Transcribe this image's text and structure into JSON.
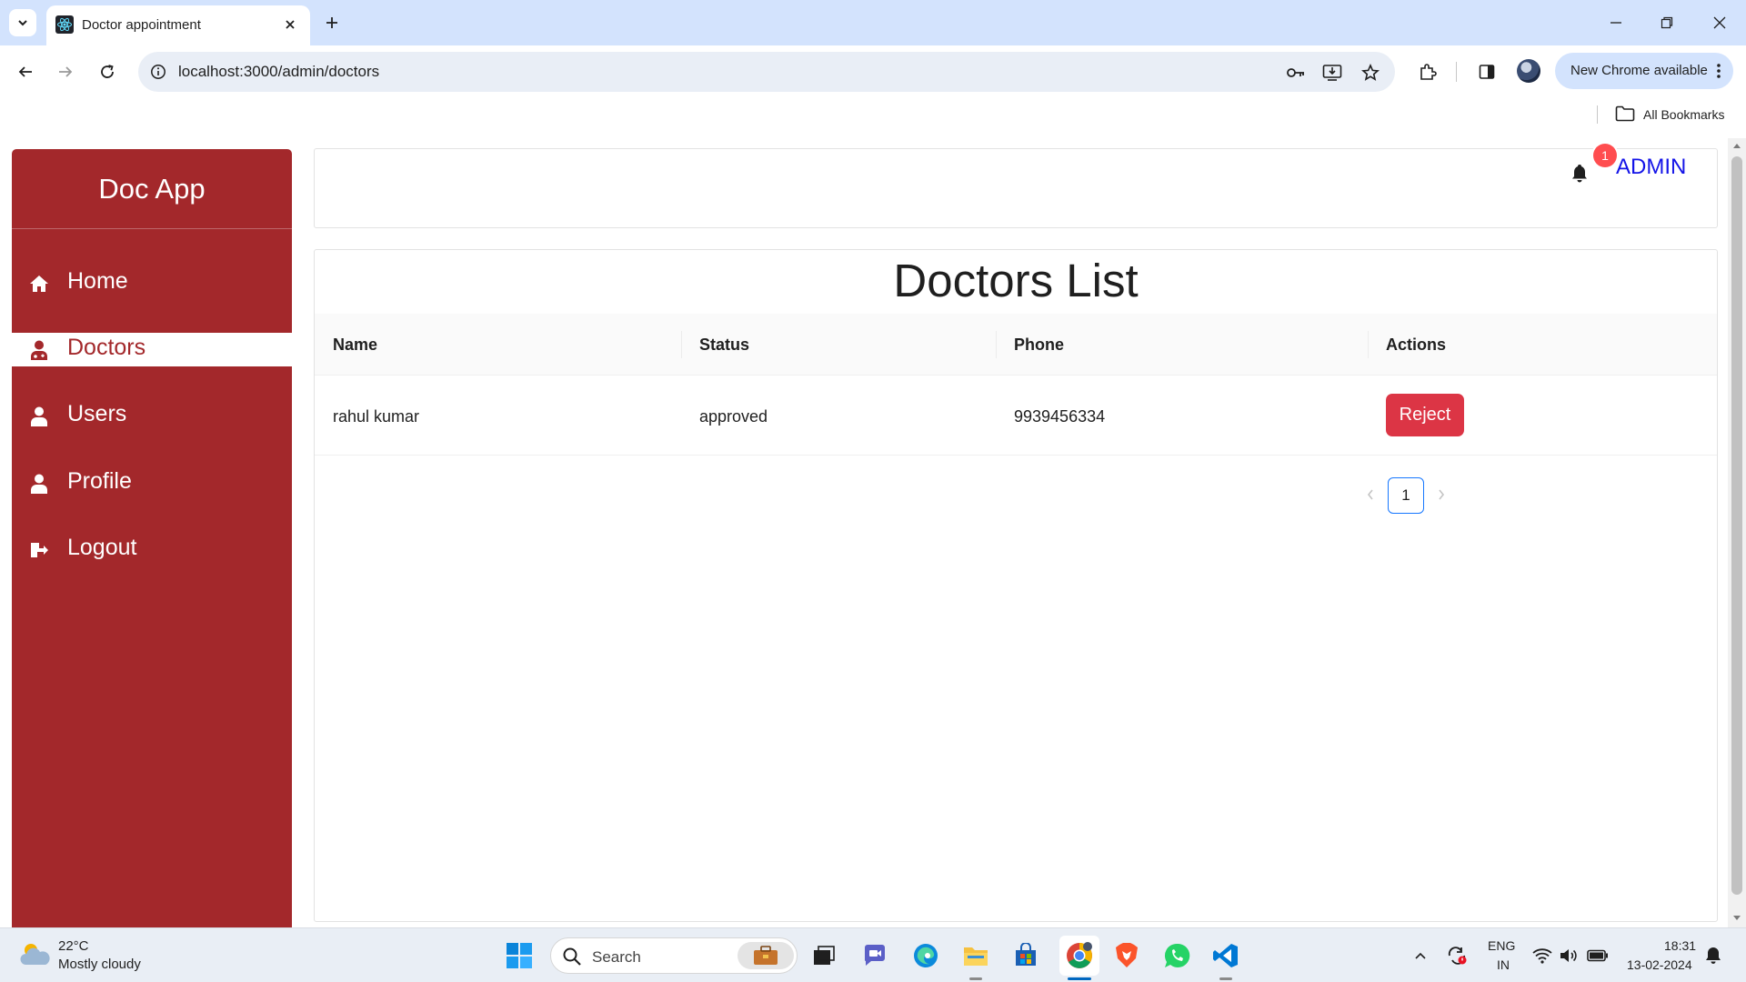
{
  "browser": {
    "tab_title": "Doctor appointment",
    "url": "localhost:3000/admin/doctors",
    "update_label": "New Chrome available",
    "bookmarks_label": "All Bookmarks"
  },
  "sidebar": {
    "brand": "Doc App",
    "items": [
      {
        "label": "Home",
        "icon": "home-icon"
      },
      {
        "label": "Doctors",
        "icon": "doctor-icon",
        "active": true
      },
      {
        "label": "Users",
        "icon": "user-icon"
      },
      {
        "label": "Profile",
        "icon": "user-icon"
      },
      {
        "label": "Logout",
        "icon": "logout-icon"
      }
    ],
    "colors": {
      "background": "#a3282b",
      "active_bg": "#ffffff"
    }
  },
  "header": {
    "notification_count": "1",
    "user_name": "ADMIN",
    "colors": {
      "badge": "#ff4d4f",
      "user_link": "#1414e8"
    }
  },
  "main": {
    "title": "Doctors List",
    "table": {
      "columns": [
        "Name",
        "Status",
        "Phone",
        "Actions"
      ],
      "rows": [
        {
          "name": "rahul kumar",
          "status": "approved",
          "phone": "9939456334",
          "action": "Reject"
        }
      ]
    },
    "pagination": {
      "current_page": "1"
    },
    "colors": {
      "reject_button": "#dc3545",
      "active_page_border": "#1677ff"
    }
  },
  "taskbar": {
    "weather_temp": "22°C",
    "weather_desc": "Mostly cloudy",
    "search_placeholder": "Search",
    "lang_primary": "ENG",
    "lang_secondary": "IN",
    "time": "18:31",
    "date": "13-02-2024"
  }
}
